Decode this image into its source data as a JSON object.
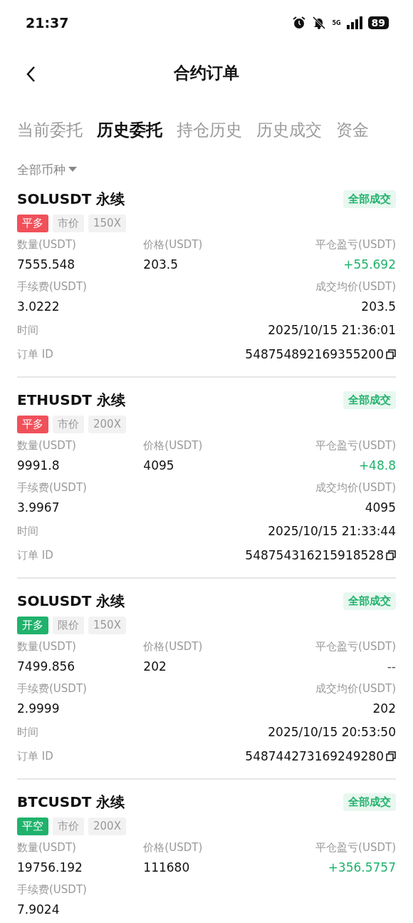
{
  "status_bar": {
    "time": "21:37",
    "network": "5G",
    "battery": "89"
  },
  "header": {
    "title": "合约订单"
  },
  "tabs": [
    {
      "label": "当前委托",
      "selected": false
    },
    {
      "label": "历史委托",
      "selected": true
    },
    {
      "label": "持仓历史",
      "selected": false
    },
    {
      "label": "历史成交",
      "selected": false
    },
    {
      "label": "资金",
      "selected": false
    }
  ],
  "filter": {
    "label": "全部币种"
  },
  "orders": [
    {
      "symbol": "SOLUSDT 永续",
      "status": "全部成交",
      "tags": [
        {
          "label": "平多",
          "color": "#f0505a"
        },
        {
          "label": "市价"
        },
        {
          "label": "150X"
        }
      ],
      "fields": [
        {
          "label": "数量(USDT)",
          "value": "7555.548"
        },
        {
          "label": "价格(USDT)",
          "value": "203.5"
        },
        {
          "label": "平仓盈亏(USDT)",
          "value": "+55.692",
          "color": "#20b26c"
        },
        {
          "label": "手续费(USDT)",
          "value": "3.0222"
        },
        {
          "label": "成交均价(USDT)",
          "value": "203.5"
        }
      ],
      "time": {
        "label": "时间",
        "value": "2025/10/15 21:36:01"
      },
      "order_id": {
        "label": "订单 ID",
        "value": "548754892169355200"
      }
    },
    {
      "symbol": "ETHUSDT 永续",
      "status": "全部成交",
      "tags": [
        {
          "label": "平多",
          "color": "#f0505a"
        },
        {
          "label": "市价"
        },
        {
          "label": "200X"
        }
      ],
      "fields": [
        {
          "label": "数量(USDT)",
          "value": "9991.8"
        },
        {
          "label": "价格(USDT)",
          "value": "4095"
        },
        {
          "label": "平仓盈亏(USDT)",
          "value": "+48.8",
          "color": "#20b26c"
        },
        {
          "label": "手续费(USDT)",
          "value": "3.9967"
        },
        {
          "label": "成交均价(USDT)",
          "value": "4095"
        }
      ],
      "time": {
        "label": "时间",
        "value": "2025/10/15 21:33:44"
      },
      "order_id": {
        "label": "订单 ID",
        "value": "548754316215918528"
      }
    },
    {
      "symbol": "SOLUSDT 永续",
      "status": "全部成交",
      "tags": [
        {
          "label": "开多",
          "color": "#20b26c"
        },
        {
          "label": "限价"
        },
        {
          "label": "150X"
        }
      ],
      "fields": [
        {
          "label": "数量(USDT)",
          "value": "7499.856"
        },
        {
          "label": "价格(USDT)",
          "value": "202"
        },
        {
          "label": "平仓盈亏(USDT)",
          "value": "--",
          "color": "#555555"
        },
        {
          "label": "手续费(USDT)",
          "value": "2.9999"
        },
        {
          "label": "成交均价(USDT)",
          "value": "202"
        }
      ],
      "time": {
        "label": "时间",
        "value": "2025/10/15 20:53:50"
      },
      "order_id": {
        "label": "订单 ID",
        "value": "548744273169249280"
      }
    },
    {
      "symbol": "BTCUSDT 永续",
      "status": "全部成交",
      "tags": [
        {
          "label": "平空",
          "color": "#20b26c"
        },
        {
          "label": "市价"
        },
        {
          "label": "200X"
        }
      ],
      "fields": [
        {
          "label": "数量(USDT)",
          "value": "19756.192"
        },
        {
          "label": "价格(USDT)",
          "value": "111680"
        },
        {
          "label": "平仓盈亏(USDT)",
          "value": "+356.5757",
          "color": "#20b26c"
        },
        {
          "label": "手续费(USDT)",
          "value": "7.9024"
        }
      ]
    }
  ]
}
